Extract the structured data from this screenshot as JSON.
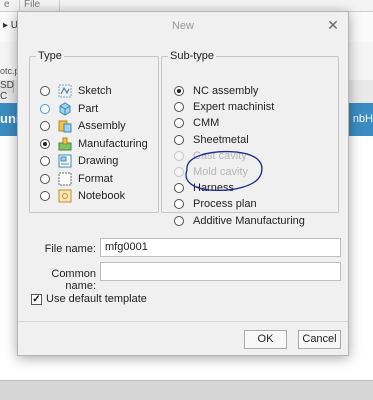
{
  "background": {
    "tab1": "e",
    "tab2": "File",
    "caret": "▸ U",
    "file_text": "otc.p",
    "tab3": "SD C",
    "banner_left": "unit",
    "banner_right": "nbH"
  },
  "dialog": {
    "title": "New",
    "type_legend": "Type",
    "subtype_legend": "Sub-type",
    "types": [
      {
        "label": "Sketch",
        "icon": "sketch-icon",
        "selected": false
      },
      {
        "label": "Part",
        "icon": "part-icon",
        "selected": false
      },
      {
        "label": "Assembly",
        "icon": "assembly-icon",
        "selected": false
      },
      {
        "label": "Manufacturing",
        "icon": "manufacturing-icon",
        "selected": true
      },
      {
        "label": "Drawing",
        "icon": "drawing-icon",
        "selected": false
      },
      {
        "label": "Format",
        "icon": "format-icon",
        "selected": false
      },
      {
        "label": "Notebook",
        "icon": "notebook-icon",
        "selected": false
      }
    ],
    "subtypes": [
      {
        "label": "NC assembly",
        "selected": true,
        "disabled": false
      },
      {
        "label": "Expert machinist",
        "selected": false,
        "disabled": false
      },
      {
        "label": "CMM",
        "selected": false,
        "disabled": false
      },
      {
        "label": "Sheetmetal",
        "selected": false,
        "disabled": false
      },
      {
        "label": "Cast cavity",
        "selected": false,
        "disabled": true
      },
      {
        "label": "Mold cavity",
        "selected": false,
        "disabled": true
      },
      {
        "label": "Harness",
        "selected": false,
        "disabled": false
      },
      {
        "label": "Process plan",
        "selected": false,
        "disabled": false
      },
      {
        "label": "Additive Manufacturing",
        "selected": false,
        "disabled": false
      }
    ],
    "file_name_label": "File name:",
    "file_name_value": "mfg0001",
    "common_name_label": "Common name:",
    "common_name_value": "",
    "default_template_label": "Use default template",
    "default_template_checked": true,
    "ok_label": "OK",
    "cancel_label": "Cancel"
  },
  "colors": {
    "banner": "#3b8cc2",
    "annotation": "#1b2a8c",
    "disabled_text": "#b5b5b5"
  }
}
